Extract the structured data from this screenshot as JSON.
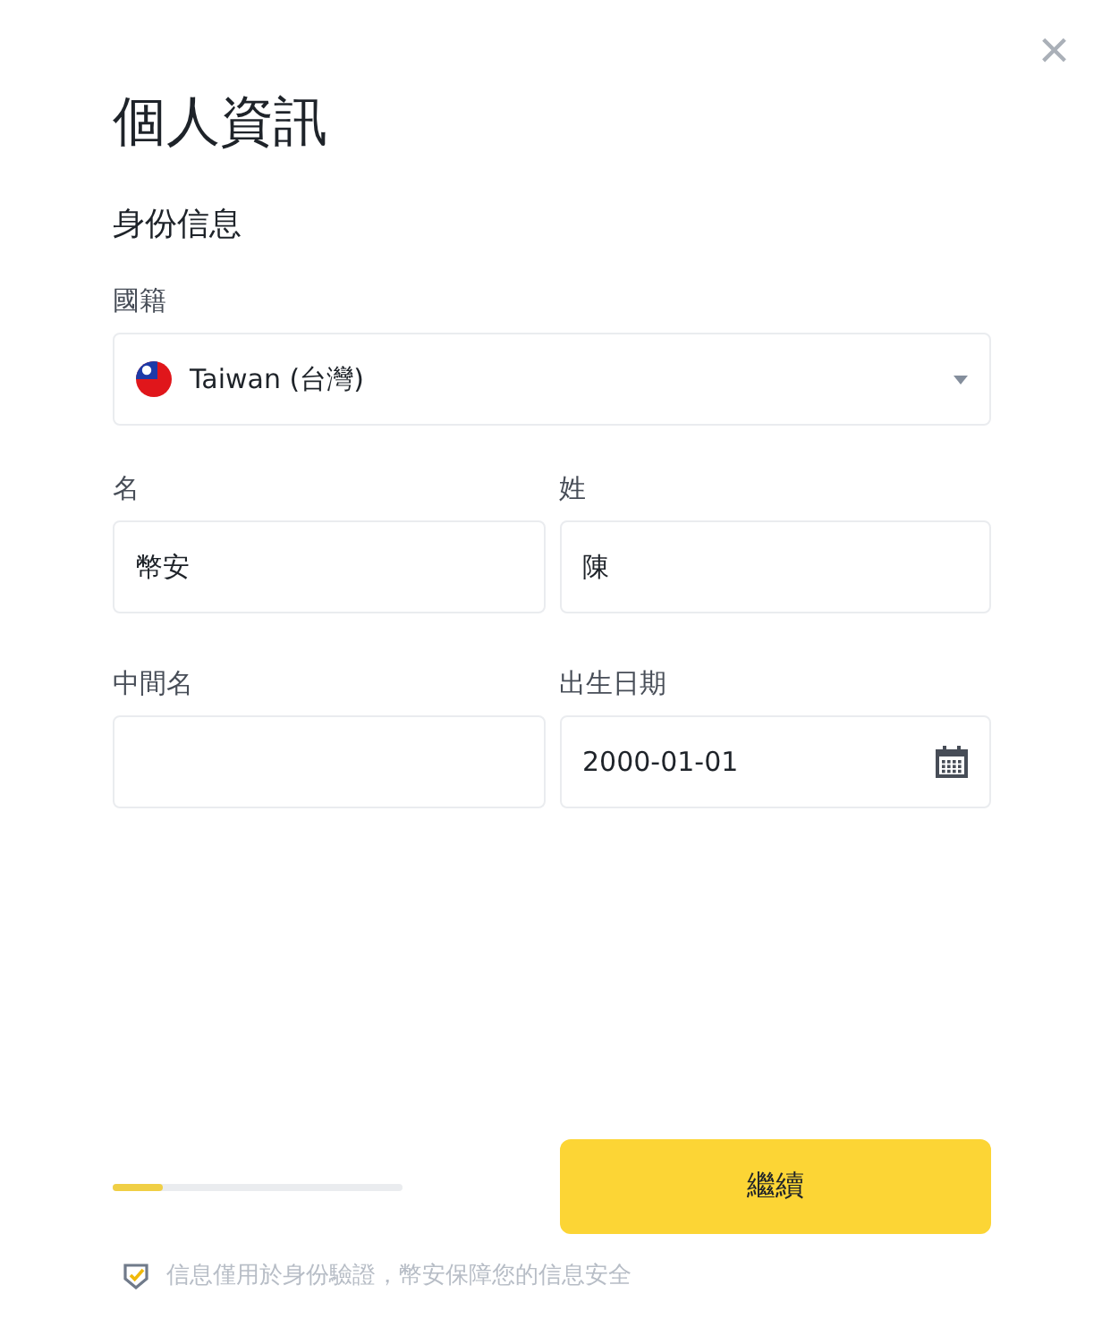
{
  "dialog": {
    "title": "個人資訊",
    "close": "×"
  },
  "section": "身份信息",
  "nationality": {
    "label": "國籍",
    "value": "Taiwan (台灣)"
  },
  "fields": [
    {
      "label": "名",
      "value": "幣安",
      "kind": "text"
    },
    {
      "label": "姓",
      "value": "陳",
      "kind": "text"
    },
    {
      "label": "中間名",
      "kind": "text"
    },
    {
      "label": "出生日期",
      "value": "2000-01-01",
      "kind": "date"
    }
  ],
  "progress": {
    "level": 0.17
  },
  "continue_button": "繼續",
  "notice": "信息僅用於身份驗證，幣安保障您的信息安全"
}
